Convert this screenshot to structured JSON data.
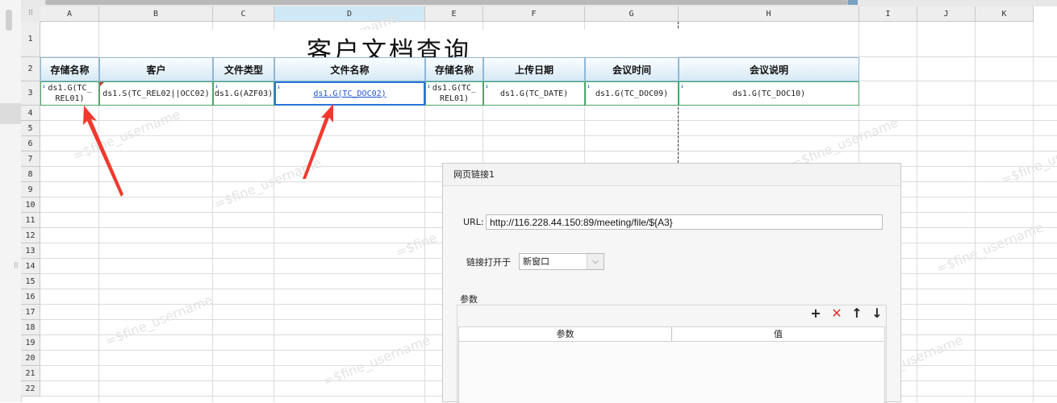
{
  "sheet": {
    "columns": [
      "A",
      "B",
      "C",
      "D",
      "E",
      "F",
      "G",
      "H",
      "I",
      "J",
      "K"
    ],
    "rows": [
      "1",
      "2",
      "3",
      "4",
      "5",
      "6",
      "7",
      "8",
      "9",
      "10",
      "11",
      "12",
      "13",
      "14",
      "15",
      "16",
      "17",
      "18",
      "19",
      "20",
      "21",
      "22"
    ],
    "title": "客户文档查询",
    "headers": [
      "存储名称",
      "客户",
      "文件类型",
      "文件名称",
      "存储名称",
      "上传日期",
      "会议时间",
      "会议说明"
    ],
    "cells": [
      {
        "mk": "↓",
        "text": "ds1.G(TC_\nREL01)"
      },
      {
        "mk": "",
        "text": "ds1.S(TC_REL02||OCC02)"
      },
      {
        "mk": "↓",
        "text": "ds1.G(AZF03)"
      },
      {
        "mk": "↓",
        "text": "ds1.G(TC_DOC02)"
      },
      {
        "mk": "↓",
        "text": "ds1.G(TC_\nREL01)"
      },
      {
        "mk": "↓",
        "text": "ds1.G(TC_DATE)"
      },
      {
        "mk": "↓",
        "text": "ds1.G(TC_DOC09)"
      },
      {
        "mk": "↓",
        "text": "ds1.G(TC_DOC10)"
      }
    ],
    "watermark": "=$fine_username"
  },
  "dialog": {
    "title": "网页链接1",
    "url_label": "URL:",
    "url_value": "http://116.228.44.150:89/meeting/file/${A3}",
    "open_label": "链接打开于",
    "open_value": "新窗口",
    "params_label": "参数",
    "col_param": "参数",
    "col_value": "值",
    "tools": {
      "add": "+",
      "delete": "✕",
      "up": "↑",
      "down": "↓"
    }
  },
  "colors": {
    "accent": "#2a73d6",
    "arrow": "#f03a2f",
    "delete": "#e0302a",
    "header_border": "#8fb7d6"
  }
}
